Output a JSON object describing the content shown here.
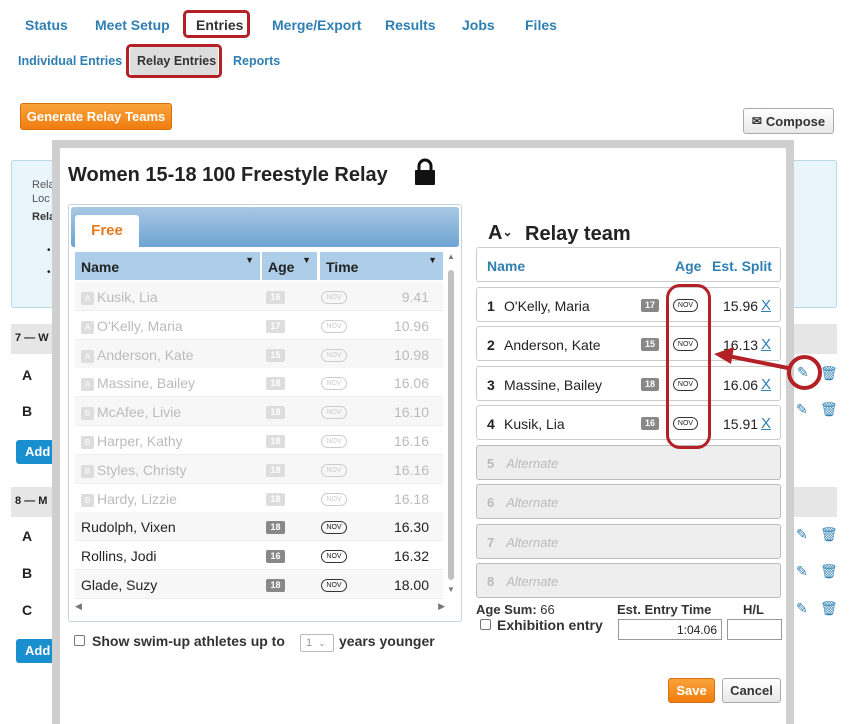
{
  "topnav": [
    "Status",
    "Meet Setup",
    "Entries",
    "Merge/Export",
    "Results",
    "Jobs",
    "Files"
  ],
  "subnav": [
    "Individual Entries",
    "Relay Entries",
    "Reports"
  ],
  "buttons": {
    "generate": "Generate Relay Teams",
    "compose": "Compose",
    "add": "Add",
    "save": "Save",
    "cancel": "Cancel"
  },
  "background": {
    "info_lines": [
      "Rela",
      "Loc",
      "Rela"
    ],
    "event7": "7 — W",
    "event8": "8 — M",
    "rows7": [
      "A",
      "B"
    ],
    "rows8": [
      "A",
      "B",
      "C"
    ]
  },
  "modal": {
    "title": "Women 15-18 100 Freestyle Relay",
    "tab": "Free",
    "columns": {
      "name": "Name",
      "age": "Age",
      "time": "Time"
    },
    "athletes": [
      {
        "name": "Kusik, Lia",
        "age": "16",
        "nov": "NOV",
        "time": "9.41",
        "disabled": true,
        "tag": "A"
      },
      {
        "name": "O'Kelly, Maria",
        "age": "17",
        "nov": "NOV",
        "time": "10.96",
        "disabled": true,
        "tag": "A"
      },
      {
        "name": "Anderson, Kate",
        "age": "15",
        "nov": "NOV",
        "time": "10.98",
        "disabled": true,
        "tag": "A"
      },
      {
        "name": "Massine, Bailey",
        "age": "18",
        "nov": "NOV",
        "time": "16.06",
        "disabled": true,
        "tag": "A"
      },
      {
        "name": "McAfee, Livie",
        "age": "18",
        "nov": "NOV",
        "time": "16.10",
        "disabled": true,
        "tag": "B"
      },
      {
        "name": "Harper, Kathy",
        "age": "18",
        "nov": "NOV",
        "time": "16.16",
        "disabled": true,
        "tag": "B"
      },
      {
        "name": "Styles, Christy",
        "age": "18",
        "nov": "NOV",
        "time": "16.16",
        "disabled": true,
        "tag": "B"
      },
      {
        "name": "Hardy, Lizzie",
        "age": "18",
        "nov": "NOV",
        "time": "16.18",
        "disabled": true,
        "tag": "B"
      },
      {
        "name": "Rudolph, Vixen",
        "age": "18",
        "nov": "NOV",
        "time": "16.30",
        "disabled": false,
        "tag": ""
      },
      {
        "name": "Rollins, Jodi",
        "age": "16",
        "nov": "NOV",
        "time": "16.32",
        "disabled": false,
        "tag": ""
      },
      {
        "name": "Glade, Suzy",
        "age": "18",
        "nov": "NOV",
        "time": "18.00",
        "disabled": false,
        "tag": ""
      }
    ],
    "swimup_label_pre": "Show swim-up athletes up to",
    "swimup_value": "1",
    "swimup_label_post": "years younger",
    "relay_letter": "A",
    "relay_title": "Relay team",
    "relay_cols": {
      "name": "Name",
      "age": "Age",
      "split": "Est. Split"
    },
    "relay_members": [
      {
        "no": "1",
        "name": "O'Kelly, Maria",
        "age": "17",
        "nov": "NOV",
        "split": "15.96",
        "x": "X"
      },
      {
        "no": "2",
        "name": "Anderson, Kate",
        "age": "15",
        "nov": "NOV",
        "split": "16.13",
        "x": "X"
      },
      {
        "no": "3",
        "name": "Massine, Bailey",
        "age": "18",
        "nov": "NOV",
        "split": "16.06",
        "x": "X"
      },
      {
        "no": "4",
        "name": "Kusik, Lia",
        "age": "16",
        "nov": "NOV",
        "split": "15.91",
        "x": "X"
      }
    ],
    "alternates": [
      {
        "no": "5",
        "label": "Alternate"
      },
      {
        "no": "6",
        "label": "Alternate"
      },
      {
        "no": "7",
        "label": "Alternate"
      },
      {
        "no": "8",
        "label": "Alternate"
      }
    ],
    "age_sum_label": "Age Sum:",
    "age_sum": "66",
    "exhibition_label": "Exhibition entry",
    "est_entry_label": "Est. Entry Time",
    "est_entry_value": "1:04.06",
    "hl_label": "H/L"
  },
  "colors": {
    "accent": "#2f7fb2",
    "highlight": "#b32025",
    "orange": "#f08a1c"
  }
}
